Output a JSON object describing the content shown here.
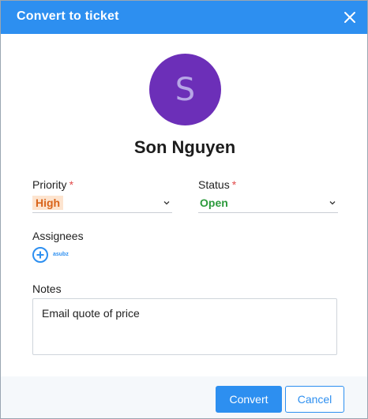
{
  "dialog": {
    "title": "Convert to ticket",
    "close_icon": "close-icon"
  },
  "contact": {
    "avatar_initial": "S",
    "avatar_color": "#6c2fb8",
    "name": "Son Nguyen"
  },
  "priority": {
    "label": "Priority",
    "required_mark": "*",
    "value": "High",
    "value_color": "#d9641a",
    "icon": "chevron-down-icon"
  },
  "status": {
    "label": "Status",
    "required_mark": "*",
    "value": "Open",
    "value_color": "#2c9a3c",
    "icon": "chevron-down-icon"
  },
  "assignees": {
    "label": "Assignees",
    "add_icon": "plus-circle-icon",
    "logo_text": "asubz"
  },
  "notes": {
    "label": "Notes",
    "value": "Email quote of price"
  },
  "footer": {
    "convert_label": "Convert",
    "cancel_label": "Cancel"
  },
  "colors": {
    "accent": "#2d8ff0",
    "required": "#e24b4b"
  }
}
